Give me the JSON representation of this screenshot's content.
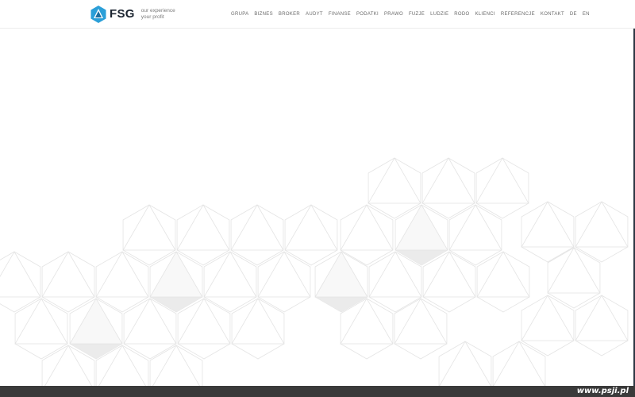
{
  "header": {
    "logo_text": "FSG",
    "tagline_line1": "our experience",
    "tagline_line2": "your profit",
    "brand_color": "#2b9fd8",
    "nav": [
      {
        "id": "grupa",
        "label": "GRUPA"
      },
      {
        "id": "biznes",
        "label": "BIZNES"
      },
      {
        "id": "broker",
        "label": "BROKER"
      },
      {
        "id": "audyt",
        "label": "AUDYT"
      },
      {
        "id": "finanse",
        "label": "FINANSE"
      },
      {
        "id": "podatki",
        "label": "PODATKI"
      },
      {
        "id": "prawo",
        "label": "PRAWO"
      },
      {
        "id": "fuzje",
        "label": "FUZJE"
      },
      {
        "id": "ludzie",
        "label": "LUDZIE"
      },
      {
        "id": "rodo",
        "label": "RODO"
      },
      {
        "id": "klienci",
        "label": "KLIENCI"
      },
      {
        "id": "referencje",
        "label": "REFERENCJE"
      },
      {
        "id": "kontakt",
        "label": "KONTAKT"
      },
      {
        "id": "de",
        "label": "DE"
      },
      {
        "id": "en",
        "label": "EN"
      }
    ]
  },
  "footer": {
    "watermark": "www.psji.pl"
  }
}
